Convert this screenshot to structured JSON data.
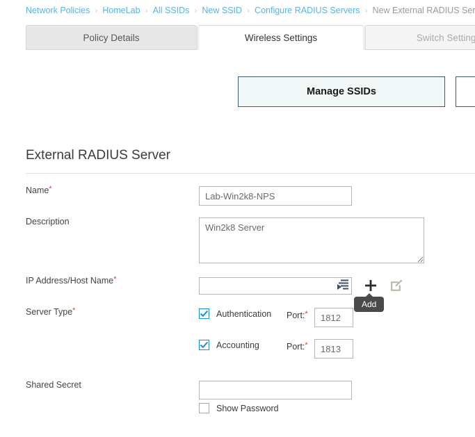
{
  "breadcrumb": {
    "separator": "›",
    "items": [
      {
        "label": "Network Policies",
        "current": false
      },
      {
        "label": "HomeLab",
        "current": false
      },
      {
        "label": "All SSIDs",
        "current": false
      },
      {
        "label": "New SSID",
        "current": false
      },
      {
        "label": "Configure RADIUS Servers",
        "current": false
      },
      {
        "label": "New External RADIUS Serv",
        "current": true
      }
    ]
  },
  "tabs": [
    {
      "label": "Policy Details",
      "state": "inactive-dark"
    },
    {
      "label": "Wireless Settings",
      "state": "active"
    },
    {
      "label": "Switch Settings",
      "state": "inactive-light"
    }
  ],
  "buttons": {
    "manage_ssids": "Manage SSIDs",
    "secondary": ""
  },
  "section": {
    "title": "External RADIUS Server"
  },
  "form": {
    "name": {
      "label": "Name",
      "required": "*",
      "value": "Lab-Win2k8-NPS",
      "placeholder": ""
    },
    "description": {
      "label": "Description",
      "value": "Win2k8 Server",
      "placeholder": ""
    },
    "ip_address": {
      "label": "IP Address/Host Name",
      "required": "*",
      "value": "",
      "placeholder": "",
      "list_icon": "list-select-icon",
      "add_icon": "plus-icon",
      "edit_icon": "edit-square-icon",
      "tooltip": "Add"
    },
    "server_type": {
      "label": "Server Type",
      "required": "*",
      "options": [
        {
          "label": "Authentication",
          "checked": true,
          "port_label": "Port:",
          "port_required": "*",
          "port_value": "1812"
        },
        {
          "label": "Accounting",
          "checked": true,
          "port_label": "Port:",
          "port_required": "*",
          "port_value": "1813"
        }
      ]
    },
    "shared_secret": {
      "label": "Shared Secret",
      "value": "",
      "placeholder": "",
      "show_password_label": "Show Password",
      "show_password_checked": false
    }
  },
  "colors": {
    "link": "#5bb2e5",
    "required": "#e8402a",
    "checkbox": "#1a8fd0",
    "button_border": "#3d5a75",
    "button_fill": "#f2f7f8",
    "tooltip_bg": "#4a4a4a"
  }
}
